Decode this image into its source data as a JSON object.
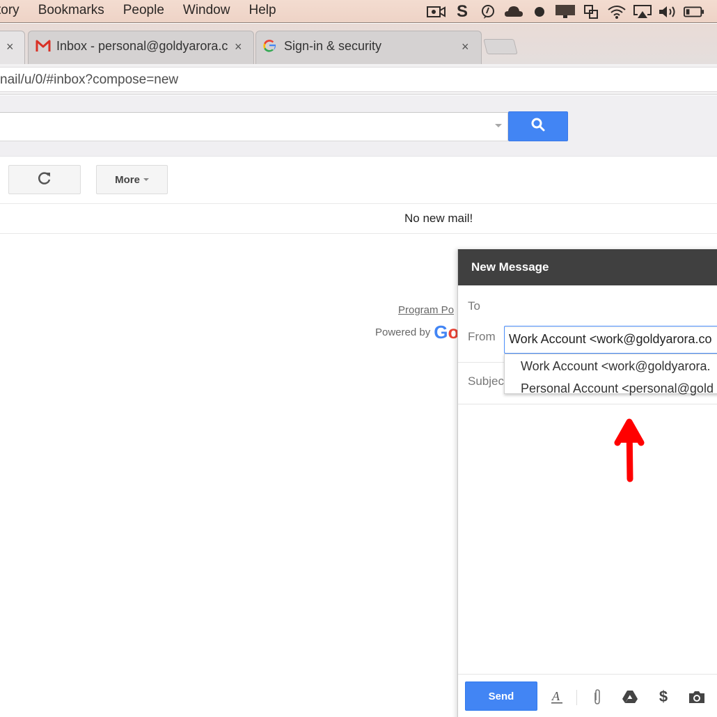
{
  "menubar": {
    "items": [
      "tory",
      "Bookmarks",
      "People",
      "Window",
      "Help"
    ],
    "status_icons": [
      "screen-record-icon",
      "skype-icon",
      "messenger-icon",
      "cloud-icon",
      "record-dot-icon",
      "display-icon",
      "window-switch-icon",
      "wifi-icon",
      "airplay-icon",
      "volume-icon",
      "battery-icon"
    ]
  },
  "tabs": [
    {
      "title": "",
      "icon": "",
      "close": "×"
    },
    {
      "title": "Inbox - personal@goldyarora.c",
      "icon": "gmail-icon",
      "close": "×"
    },
    {
      "title": "Sign-in & security",
      "icon": "google-icon",
      "close": "×"
    }
  ],
  "address_bar": {
    "url": "nail/u/0/#inbox?compose=new"
  },
  "gmail": {
    "search": {
      "placeholder": ""
    },
    "toolbar": {
      "more_label": "More"
    },
    "empty_message": "No new mail!",
    "footer": {
      "program_policies": "Program Po",
      "powered_by": "Powered by",
      "logo": "Go"
    }
  },
  "compose": {
    "title": "New Message",
    "to_label": "To",
    "from_label": "From",
    "from_value": "Work Account <work@goldyarora.co",
    "subject_label": "Subjec",
    "from_options": [
      "Work Account <work@goldyarora.",
      "Personal Account <personal@gold"
    ],
    "send_label": "Send"
  },
  "colors": {
    "accent": "#4285f4",
    "compose_header": "#404040",
    "annotation": "#ff0000"
  }
}
